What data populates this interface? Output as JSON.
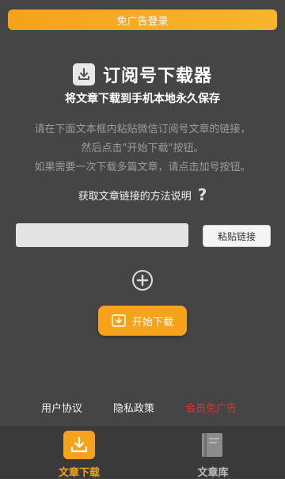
{
  "banner": {
    "label": "免广告登录"
  },
  "header": {
    "title": "订阅号下载器",
    "subtitle": "将文章下载到手机本地永久保存",
    "title_icon": "download-icon"
  },
  "instructions": {
    "line1": "请在下面文本框内粘贴微信订阅号文章的链接，",
    "line2": "然后点击\"开始下载\"按钮。",
    "line3": "如果需要一次下载多篇文章，请点击加号按钮。"
  },
  "method": {
    "label": "获取文章链接的方法说明",
    "icon": "?"
  },
  "link_input": {
    "value": "",
    "placeholder": ""
  },
  "paste_button": {
    "label": "粘贴链接"
  },
  "add_button": {
    "icon": "plus-circle-icon"
  },
  "start_button": {
    "label": "开始下载",
    "icon": "download-icon"
  },
  "footer": {
    "agreement": "用户协议",
    "privacy": "隐私政策",
    "vip": "会员免广告"
  },
  "tabs": [
    {
      "label": "文章下载",
      "icon": "download-icon",
      "active": true
    },
    {
      "label": "文章库",
      "icon": "book-icon",
      "active": false
    }
  ],
  "colors": {
    "accent": "#f6a21a",
    "background": "#454545",
    "vip": "#e0303a"
  }
}
